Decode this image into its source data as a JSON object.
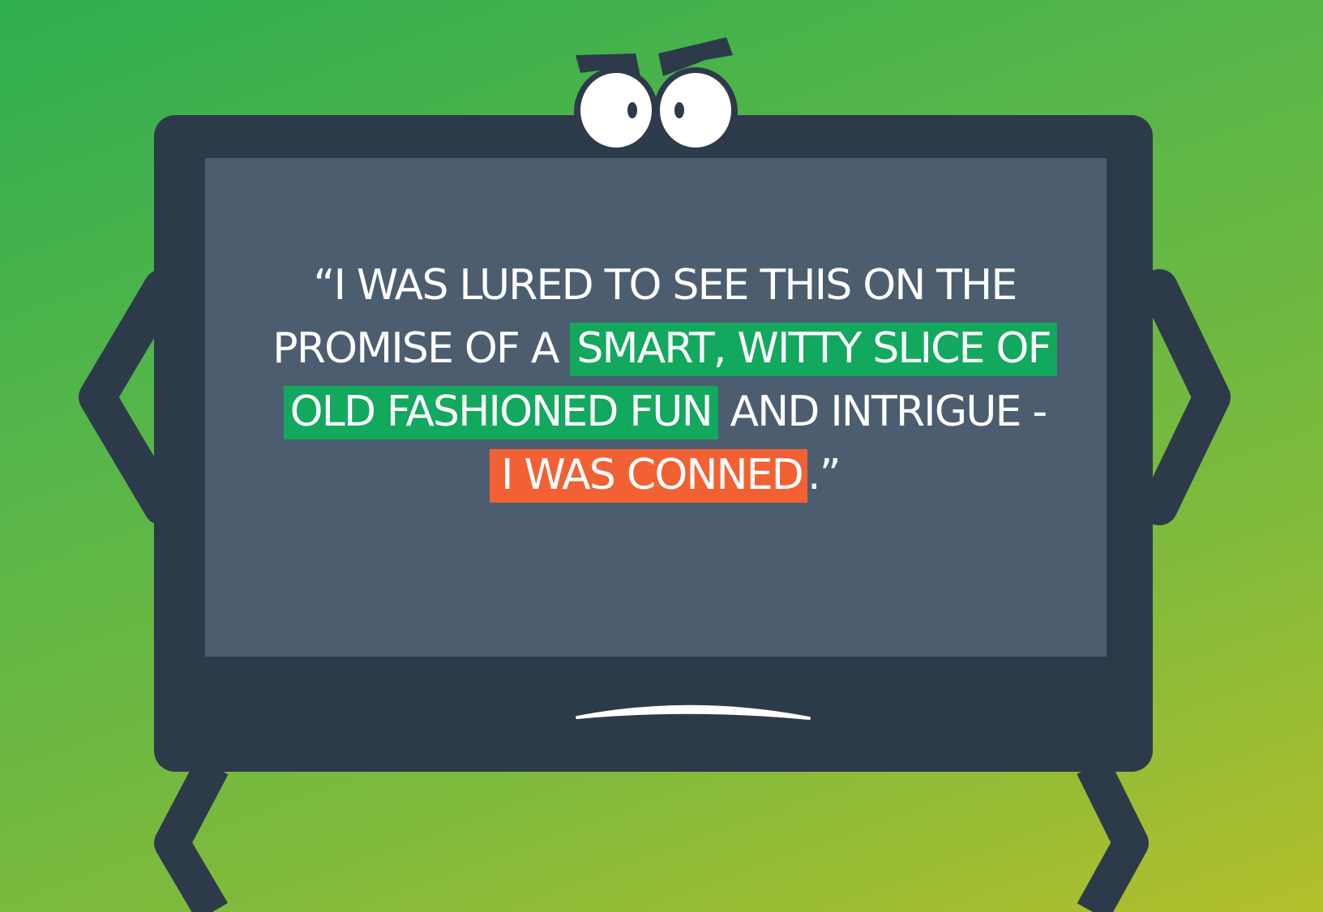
{
  "colors": {
    "background_start": "#2fae4f",
    "background_end": "#b3bf2c",
    "tv_frame": "#2d3a4a",
    "tv_screen": "#4c5d70",
    "highlight_green": "#12a85e",
    "highlight_orange": "#f26133",
    "text": "#ffffff"
  },
  "character": {
    "type": "tv-character",
    "expression": "frowning",
    "icons": [
      "eyebrow-icon",
      "eye-icon",
      "frown-mouth-icon",
      "arm-icon",
      "leg-icon"
    ]
  },
  "quote": {
    "line1": "“I WAS LURED TO SEE THIS ON THE",
    "line2_plain": "PROMISE OF A ",
    "line2_highlight": "SMART, WITTY SLICE OF",
    "line3_highlight": "OLD FASHIONED FUN",
    "line3_plain": " AND INTRIGUE -",
    "line4_highlight": "I WAS CONNED",
    "line4_plain": ".”"
  }
}
